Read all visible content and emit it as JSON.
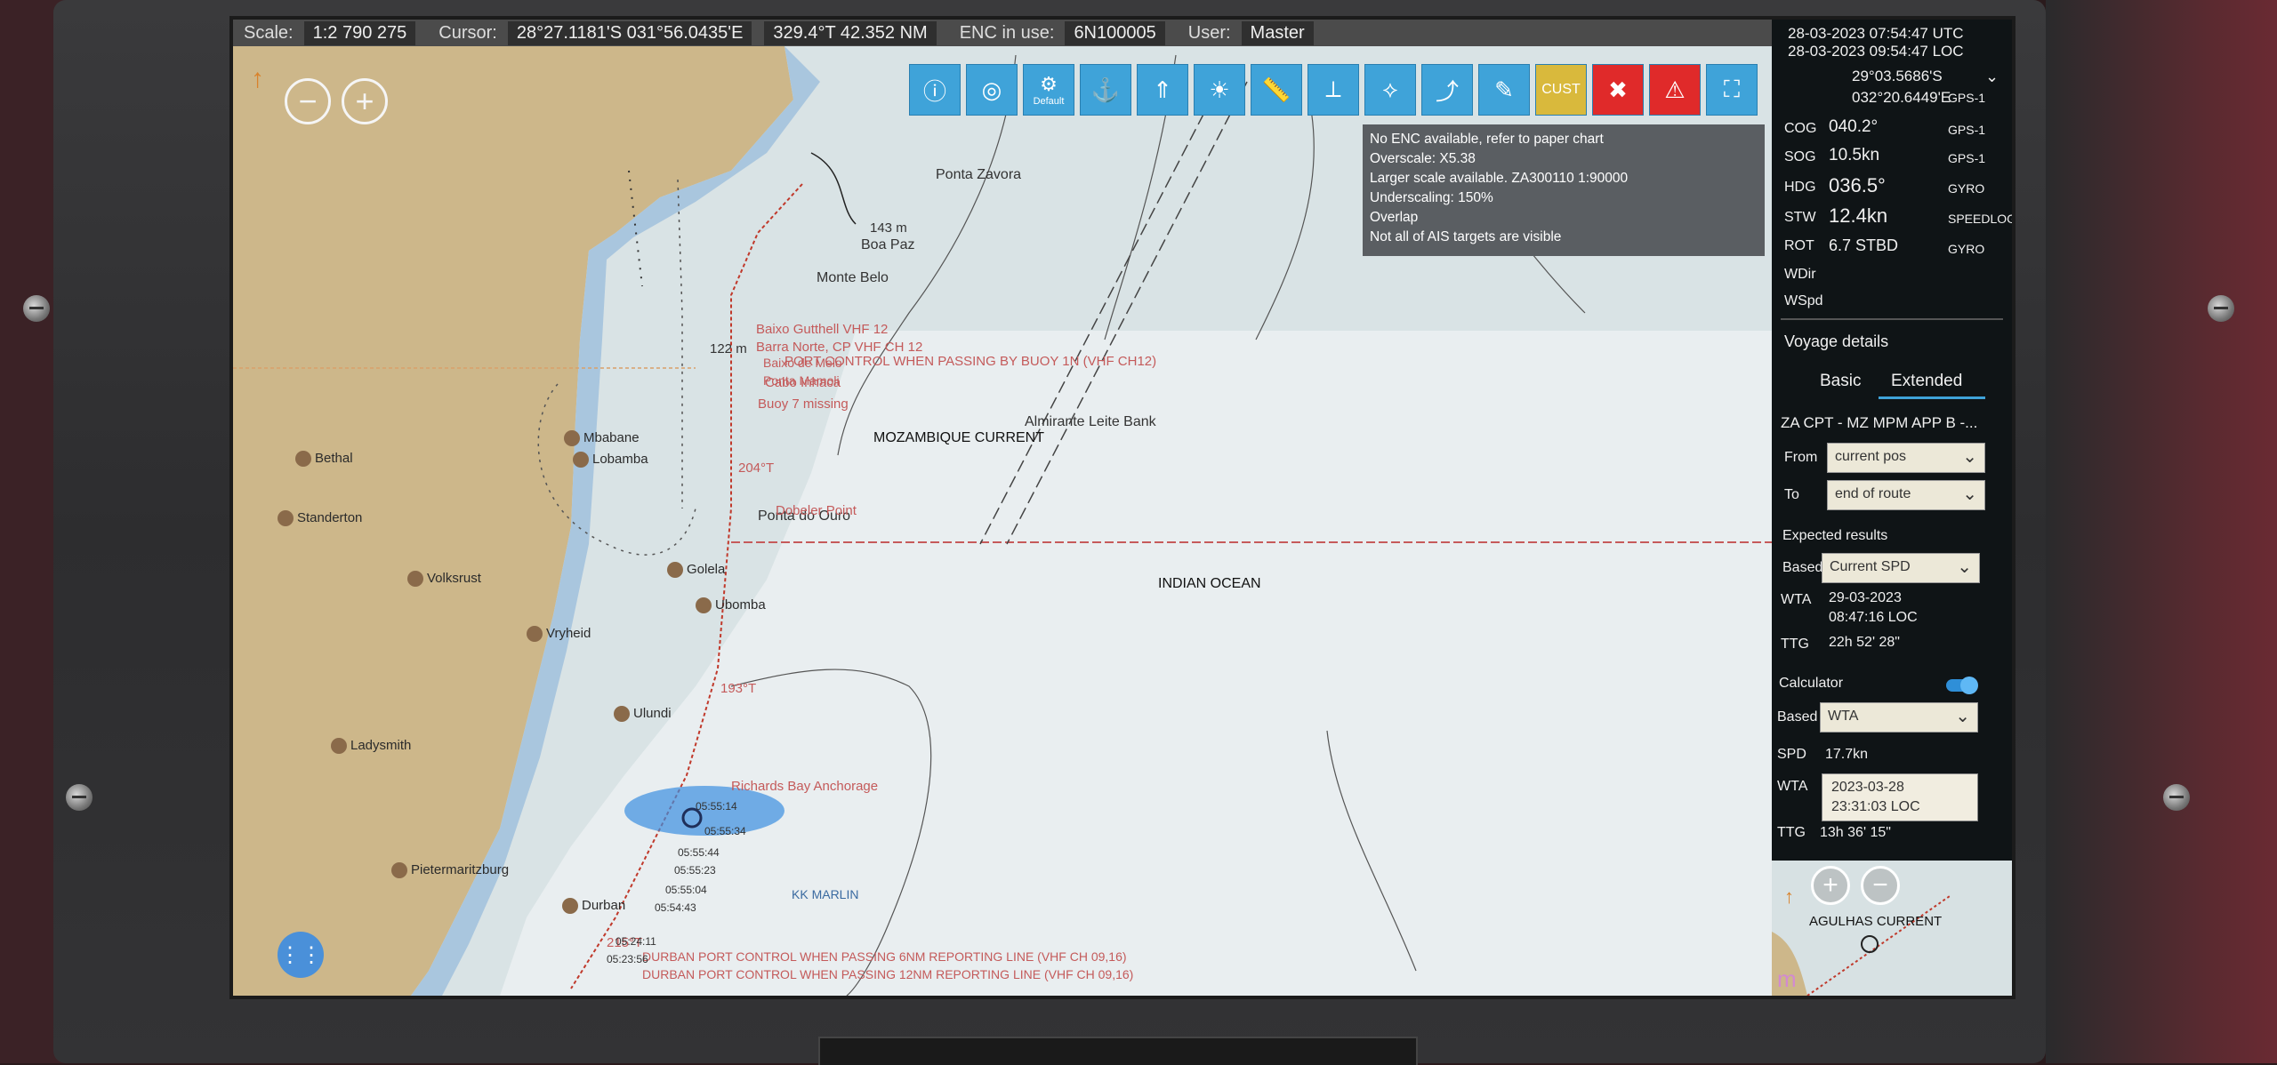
{
  "statusbar": {
    "scale_label": "Scale:",
    "scale_value": "1:2 790 275",
    "cursor_label": "Cursor:",
    "cursor_value": "28°27.1181'S 031°56.0435'E",
    "bearing_value": "329.4°T  42.352 NM",
    "enc_label": "ENC in use:",
    "enc_value": "6N100005",
    "user_label": "User:",
    "user_value": "Master"
  },
  "toolbar": {
    "defaults_label": "Default",
    "cust_label": "CUST"
  },
  "message": {
    "lines": [
      "No ENC available, refer to paper chart",
      "Overscale: X5.38",
      "Larger scale available. ZA300110 1:90000",
      "Underscaling: 150%",
      "Overlap",
      "Not all of AIS targets are visible"
    ]
  },
  "map": {
    "towns": [
      "Bethal",
      "Mbabane",
      "Lobamba",
      "Standerton",
      "Volksrust",
      "Golela",
      "Ubomba",
      "Vryheid",
      "Ulundi",
      "Ladysmith",
      "Pietermaritzburg",
      "Durban"
    ],
    "places": [
      "Ponta Zavora",
      "Boa Paz",
      "Monte Belo",
      "Ponta do Ouro",
      "Almirante Leite Bank",
      "MOZAMBIQUE CURRENT",
      "INDIAN OCEAN",
      "Richards Bay Anchorage",
      "KK MARLIN"
    ],
    "notes": [
      "PORT CONTROL WHEN PASSING BY BUOY 1N (VHF CH12)",
      "Buoy 7 missing",
      "Baixo Gutthell VHF 12",
      "Barra Norte, CP VHF CH 12",
      "Baixo de Melo",
      "Ponta Mamoli",
      "Cabo Inhaca",
      "Dobeler Point",
      "DURBAN PORT CONTROL WHEN PASSING 6NM REPORTING LINE (VHF CH 09,16)",
      "DURBAN PORT CONTROL WHEN PASSING 12NM REPORTING LINE (VHF CH 09,16)"
    ],
    "route_labels": [
      "204°T",
      "193°T",
      "215°T"
    ],
    "range_label": "122 m",
    "range_label_2": "143 m",
    "times": [
      "05:55:44",
      "05:55:23",
      "05:55:04",
      "05:54:43",
      "05:24:11",
      "05:23:56",
      "05:55:14",
      "05:55:34"
    ]
  },
  "nav": {
    "utc": "28-03-2023 07:54:47 UTC",
    "loc": "28-03-2023 09:54:47 LOC",
    "lat": "29°03.5686'S",
    "lon": "032°20.6449'E",
    "pos_src": "GPS-1",
    "cog_label": "COG",
    "cog": "040.2°",
    "cog_src": "GPS-1",
    "sog_label": "SOG",
    "sog": "10.5kn",
    "sog_src": "GPS-1",
    "hdg_label": "HDG",
    "hdg": "036.5°",
    "hdg_src": "GYRO",
    "stw_label": "STW",
    "stw": "12.4kn",
    "stw_src": "SPEEDLOG",
    "rot_label": "ROT",
    "rot": "6.7 STBD",
    "rot_src": "GYRO",
    "wdir_label": "WDir",
    "wspd_label": "WSpd"
  },
  "voyage": {
    "title": "Voyage details",
    "tab_basic": "Basic",
    "tab_extended": "Extended",
    "route_name": "ZA CPT - MZ MPM APP B -...",
    "from_label": "From",
    "from_value": "current pos",
    "to_label": "To",
    "to_value": "end of route",
    "expected_label": "Expected results",
    "based_on_label": "Based on",
    "based_on_value": "Current SPD",
    "wta_label": "WTA",
    "wta_date": "29-03-2023",
    "wta_time": "08:47:16 LOC",
    "ttg_label": "TTG",
    "ttg_value": "22h 52' 28\"",
    "calc_label": "Calculator",
    "calc_based_label": "Based on",
    "calc_based_value": "WTA",
    "spd_label": "SPD",
    "spd_value": "17.7kn",
    "calc_wta_label": "WTA",
    "calc_wta_date": "2023-03-28",
    "calc_wta_time": "23:31:03 LOC",
    "calc_ttg_label": "TTG",
    "calc_ttg_value": "13h 36' 15\""
  },
  "minimap": {
    "label": "AGULHAS CURRENT",
    "corner": "m"
  }
}
